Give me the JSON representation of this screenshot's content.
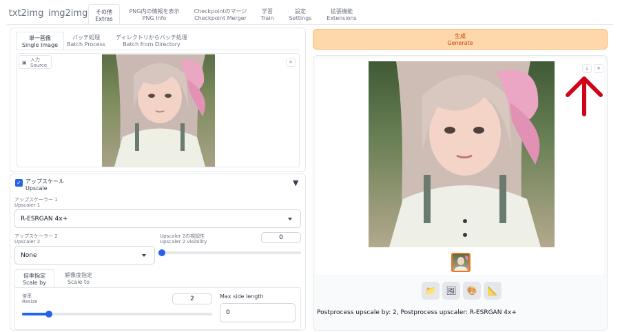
{
  "top_tabs": [
    {
      "jp": "txt2img",
      "en": ""
    },
    {
      "jp": "img2img",
      "en": ""
    },
    {
      "jp": "その他",
      "en": "Extras"
    },
    {
      "jp": "PNG内の情報を表示",
      "en": "PNG Info"
    },
    {
      "jp": "Checkpointのマージ",
      "en": "Checkpoint Merger"
    },
    {
      "jp": "学習",
      "en": "Train"
    },
    {
      "jp": "設定",
      "en": "Settings"
    },
    {
      "jp": "拡張機能",
      "en": "Extensions"
    }
  ],
  "left": {
    "subtabs": [
      {
        "jp": "単一画像",
        "en": "Single Image"
      },
      {
        "jp": "バッチ処理",
        "en": "Batch Process"
      },
      {
        "jp": "ディレクトリからバッチ処理",
        "en": "Batch from Directory"
      }
    ],
    "source": {
      "jp": "入力",
      "en": "Source",
      "close": "×"
    },
    "upscale": {
      "checkbox_jp": "アップスケール",
      "checkbox_en": "Upscale",
      "checked": true,
      "collapse_glyph": "▼",
      "upscaler1": {
        "label_jp": "アップスケーラー 1",
        "label_en": "Upscaler 1",
        "value": "R-ESRGAN 4x+"
      },
      "upscaler2": {
        "label_jp": "アップスケーラー 2",
        "label_en": "Upscaler 2",
        "value": "None"
      },
      "visibility": {
        "label_jp": "Upscaler 2の視認性",
        "label_en": "Upscaler 2 visibility",
        "value": "0",
        "fraction": 0
      },
      "scale_tabs": [
        {
          "jp": "倍率指定",
          "en": "Scale by"
        },
        {
          "jp": "解像度指定",
          "en": "Scale to"
        }
      ],
      "resize": {
        "label_jp": "倍率",
        "label_en": "Resize",
        "value": "2",
        "fraction": 0.14
      },
      "max_side": {
        "label": "Max side length",
        "value": "0"
      }
    }
  },
  "right": {
    "generate": {
      "jp": "生成",
      "en": "Generate"
    },
    "download_glyph": "⤓",
    "close_glyph": "×",
    "arrow_color": "#d0021b",
    "info": "Postprocess upscale by: 2, Postprocess upscaler: R-ESRGAN 4x+",
    "tools": [
      {
        "glyph": "📁",
        "name": "folder-icon"
      },
      {
        "glyph": "🖼",
        "name": "image-icon"
      },
      {
        "glyph": "🎨",
        "name": "palette-icon"
      },
      {
        "glyph": "📐",
        "name": "triangle-ruler-icon"
      }
    ]
  },
  "colors": {
    "generate_bg": "#fed7aa",
    "generate_text": "#c2410c",
    "accent": "#2563eb"
  }
}
